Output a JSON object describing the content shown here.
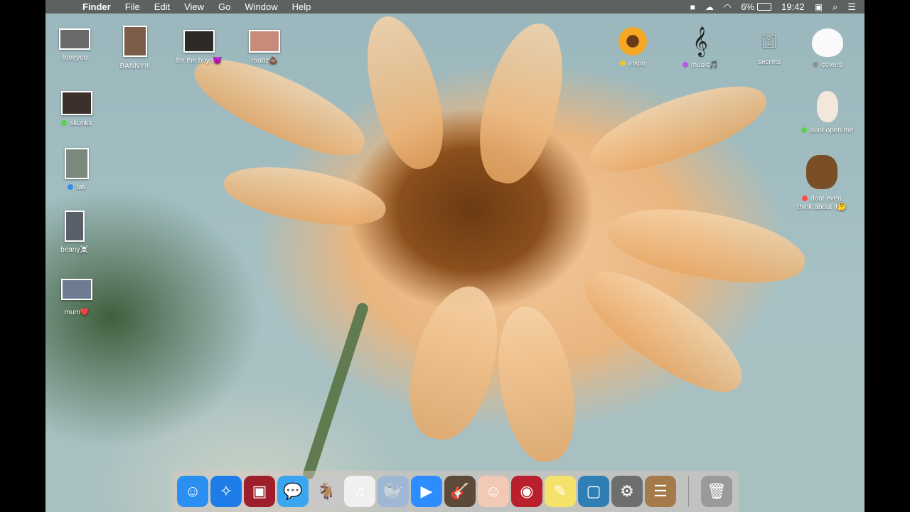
{
  "menubar": {
    "apple_glyph": "",
    "app_name": "Finder",
    "menus": [
      "File",
      "Edit",
      "View",
      "Go",
      "Window",
      "Help"
    ],
    "battery": "6%",
    "time": "19:42"
  },
  "desktop_left": [
    {
      "label": "iloveyou",
      "tag_color": ""
    },
    {
      "label": "BANNY!!!",
      "tag_color": ""
    },
    {
      "label": "for the boys😈",
      "tag_color": ""
    },
    {
      "label": "roobz💩",
      "tag_color": ""
    },
    {
      "label": "skunks",
      "tag_color": "#5bd14e"
    },
    {
      "label": "tati",
      "tag_color": "#3a8ee6"
    },
    {
      "label": "beany☠️",
      "tag_color": ""
    },
    {
      "label": "mum❤️",
      "tag_color": ""
    }
  ],
  "desktop_right": [
    {
      "label": "inspo",
      "tag_color": "#f2c431"
    },
    {
      "label": "music🎵",
      "tag_color": "#b25ae0"
    },
    {
      "label": "secrets",
      "tag_color": "#f2c431"
    },
    {
      "label": "covers",
      "tag_color": "#8e8e93"
    },
    {
      "label": "dont open me",
      "tag_color": "#5bd14e"
    },
    {
      "label_line1": "dont even",
      "label_line2": "think about it🤔",
      "tag_color": "#ff4d4d"
    }
  ],
  "dock": [
    {
      "icon": "finder-icon",
      "color": "#2a8ff0",
      "glyph": "☺"
    },
    {
      "icon": "safari-icon",
      "color": "#1e7ce8",
      "glyph": "✧"
    },
    {
      "icon": "photo-booth-icon",
      "color": "#9e1f2b",
      "glyph": "▣"
    },
    {
      "icon": "messages-icon",
      "color": "#3aa6f2",
      "glyph": "💬"
    },
    {
      "icon": "goat-app-icon",
      "color": "#c8c8c8",
      "glyph": "🐐"
    },
    {
      "icon": "itunes-icon",
      "color": "#f0f0f0",
      "glyph": "♫"
    },
    {
      "icon": "seal-app-icon",
      "color": "#9fb6d4",
      "glyph": "🦭"
    },
    {
      "icon": "zoom-icon",
      "color": "#2d8cff",
      "glyph": "▶"
    },
    {
      "icon": "garageband-icon",
      "color": "#5b4a3a",
      "glyph": "🎸"
    },
    {
      "icon": "face-app-icon",
      "color": "#f2c9b4",
      "glyph": "☺"
    },
    {
      "icon": "photo-app-icon",
      "color": "#b8202d",
      "glyph": "◉"
    },
    {
      "icon": "stickies-icon",
      "color": "#f5e26b",
      "glyph": "✎"
    },
    {
      "icon": "preview-icon",
      "color": "#2f7fb5",
      "glyph": "▢"
    },
    {
      "icon": "system-preferences-icon",
      "color": "#6e6e6e",
      "glyph": "⚙"
    },
    {
      "icon": "contacts-icon",
      "color": "#a57a4a",
      "glyph": "☰"
    },
    {
      "icon": "trash-icon",
      "color": "#9a9a9a",
      "glyph": "🗑"
    }
  ]
}
